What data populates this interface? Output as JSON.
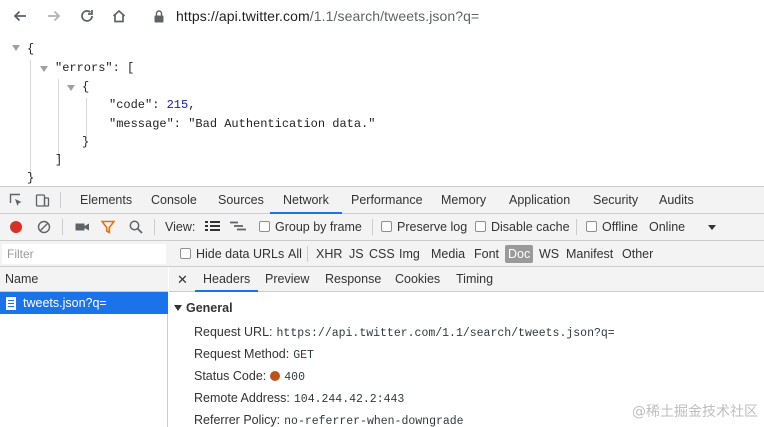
{
  "browser": {
    "url_host": "https://api.twitter.com",
    "url_path": "/1.1/search/tweets.json?q="
  },
  "json_view": {
    "open_brace": "{",
    "errors_key": "\"errors\": [",
    "inner_open": "{",
    "code_key": "\"code\": ",
    "code_value": "215",
    "code_comma": ",",
    "message_key": "\"message\": ",
    "message_value": "\"Bad Authentication data.\"",
    "inner_close": "}",
    "array_close": "]",
    "close_brace": "}"
  },
  "devtools": {
    "tabs": [
      "Elements",
      "Console",
      "Sources",
      "Network",
      "Performance",
      "Memory",
      "Application",
      "Security",
      "Audits"
    ],
    "active_tab": "Network",
    "toolbar": {
      "view_label": "View:",
      "group_by_frame": "Group by frame",
      "preserve_log": "Preserve log",
      "disable_cache": "Disable cache",
      "offline": "Offline",
      "throttling": "Online"
    },
    "filter": {
      "placeholder": "Filter",
      "hide_data_urls": "Hide data URLs",
      "types": [
        "All",
        "XHR",
        "JS",
        "CSS",
        "Img",
        "Media",
        "Font",
        "Doc",
        "WS",
        "Manifest",
        "Other"
      ],
      "active_type": "Doc"
    },
    "name_column": "Name",
    "request_name": "tweets.json?q=",
    "detail_tabs": [
      "Headers",
      "Preview",
      "Response",
      "Cookies",
      "Timing"
    ],
    "active_detail_tab": "Headers",
    "general": {
      "title": "General",
      "request_url_label": "Request URL:",
      "request_url": "https://api.twitter.com/1.1/search/tweets.json?q=",
      "request_method_label": "Request Method:",
      "request_method": "GET",
      "status_code_label": "Status Code:",
      "status_code": "400",
      "remote_address_label": "Remote Address:",
      "remote_address": "104.244.42.2:443",
      "referrer_policy_label": "Referrer Policy:",
      "referrer_policy": "no-referrer-when-downgrade"
    }
  },
  "watermark": "@稀土掘金技术社区",
  "colors": {
    "accent": "#1a73e8",
    "record": "#d93025",
    "status_error": "#c0501a",
    "json_number": "#1a1aa6"
  }
}
